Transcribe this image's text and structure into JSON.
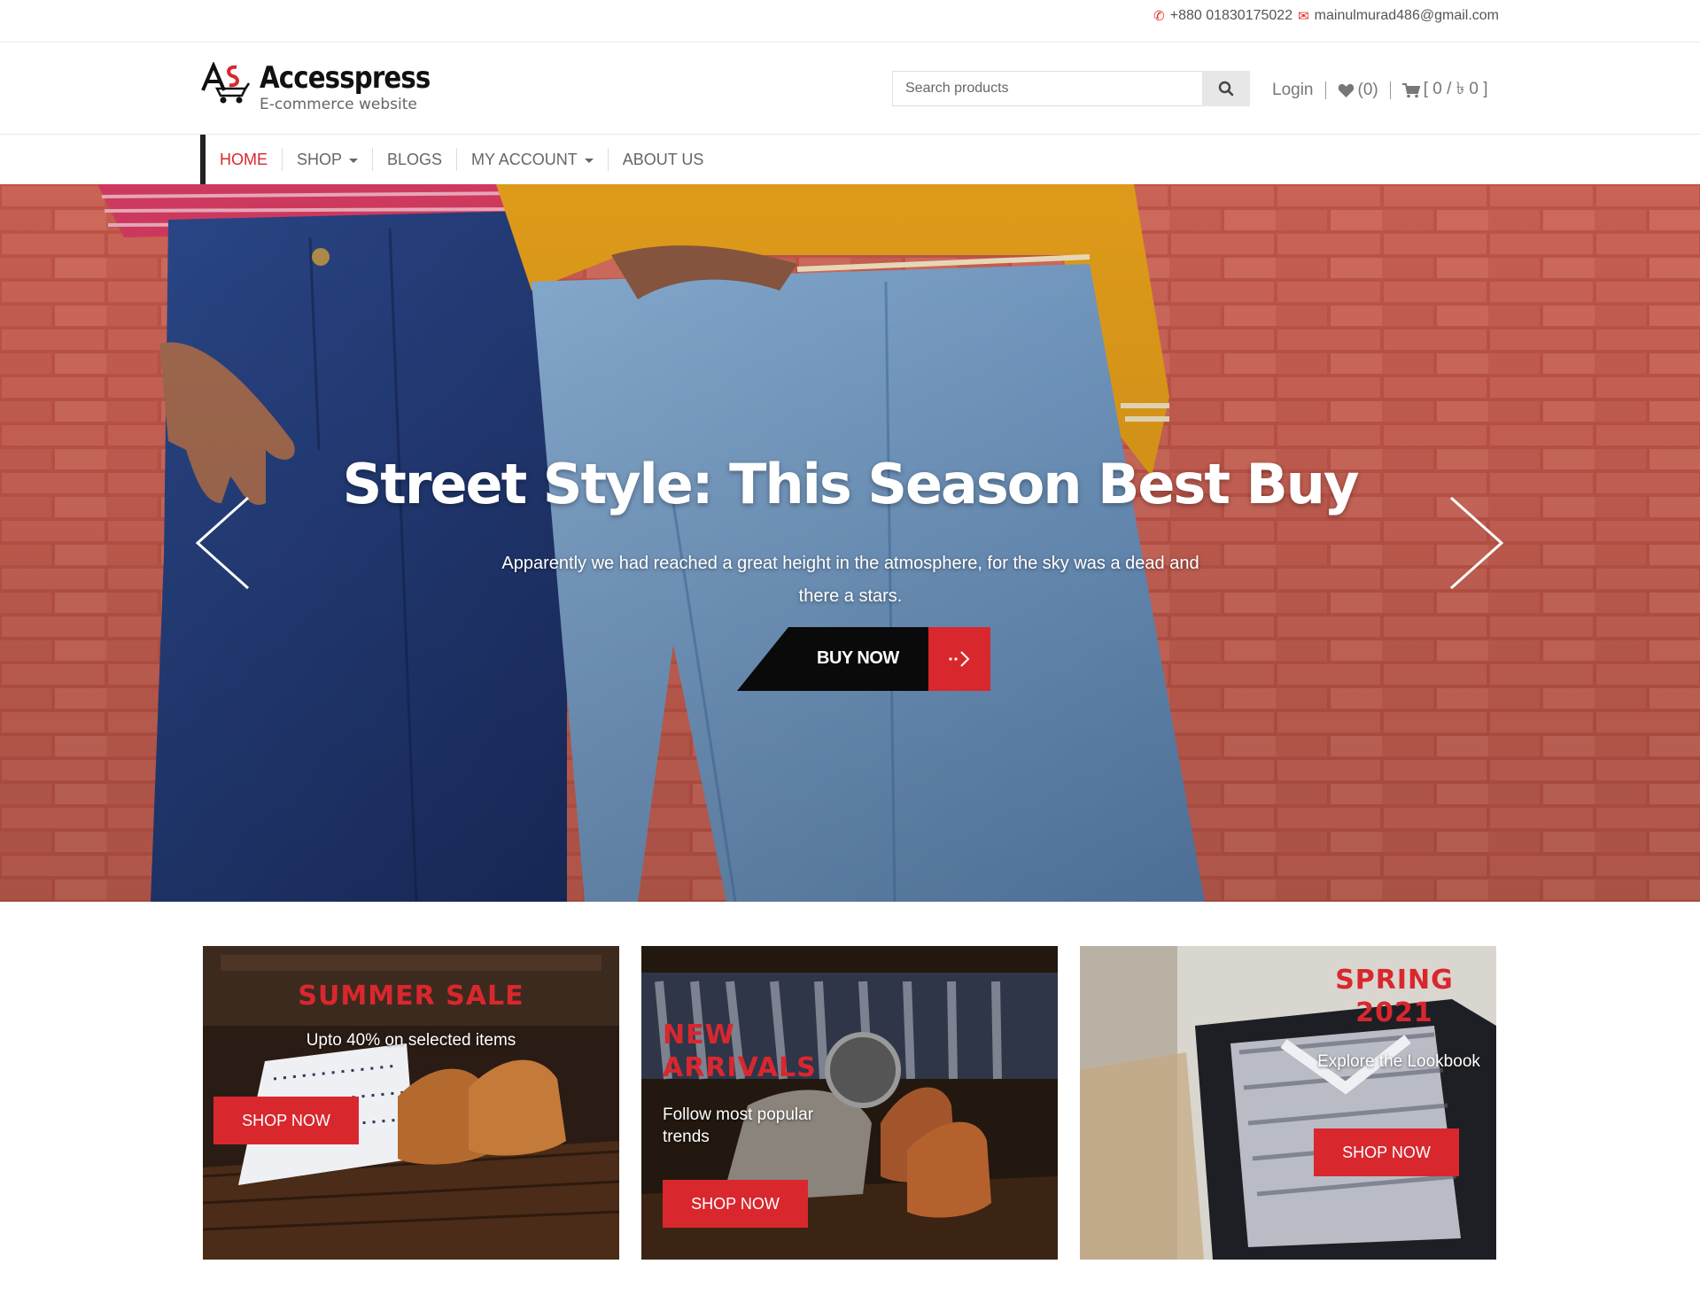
{
  "colors": {
    "accent": "#d9272e",
    "dark": "#0a0a0a",
    "text": "#555555"
  },
  "topbar": {
    "phone_icon": "phone-icon",
    "phone": "+880 01830175022",
    "email_icon": "envelope-icon",
    "email": "mainulmurad486@gmail.com"
  },
  "logo": {
    "title": "Accesspress",
    "subtitle": "E-commerce website"
  },
  "search": {
    "placeholder": "Search products",
    "icon": "search-icon"
  },
  "header_links": {
    "login": "Login",
    "wishlist_icon": "heart-icon",
    "wishlist": "(0)",
    "cart_icon": "cart-icon",
    "cart": "[ 0 / ৳ 0 ]"
  },
  "nav": {
    "items": [
      {
        "label": "HOME",
        "active": true,
        "dropdown": false
      },
      {
        "label": "SHOP",
        "active": false,
        "dropdown": true
      },
      {
        "label": "BLOGS",
        "active": false,
        "dropdown": false
      },
      {
        "label": "MY ACCOUNT",
        "active": false,
        "dropdown": true
      },
      {
        "label": "ABOUT US",
        "active": false,
        "dropdown": false
      }
    ]
  },
  "hero": {
    "title": "Street Style: This Season Best Buy",
    "description": "Apparently we had reached a great height in the atmosphere, for the sky was a dead and there a stars.",
    "button": "BUY NOW",
    "button_icon": "arrow-right-icon",
    "prev_icon": "chevron-left-icon",
    "next_icon": "chevron-right-icon"
  },
  "promos": [
    {
      "title": "SUMMER SALE",
      "subtitle": "Upto 40% on selected items",
      "button": "SHOP NOW"
    },
    {
      "title": "NEW ARRIVALS",
      "subtitle": "Follow most popular trends",
      "button": "SHOP NOW"
    },
    {
      "title": "SPRING 2021",
      "subtitle": "Explore the Lookbook",
      "button": "SHOP NOW"
    }
  ]
}
